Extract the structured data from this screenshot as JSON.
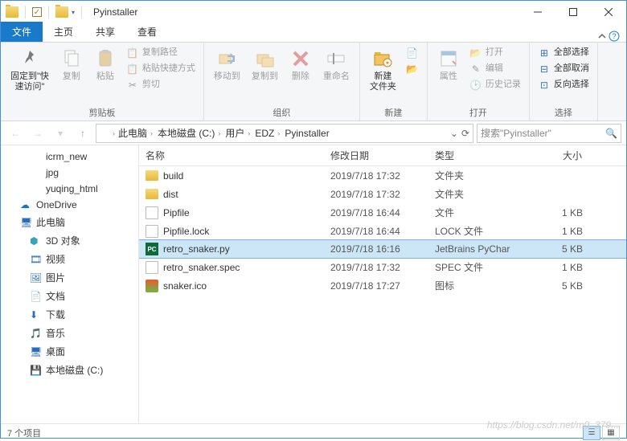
{
  "window": {
    "title": "Pyinstaller"
  },
  "tabs": {
    "file": "文件",
    "home": "主页",
    "share": "共享",
    "view": "查看"
  },
  "ribbon": {
    "pin": "固定到\"快\n速访问\"",
    "copy": "复制",
    "paste": "粘贴",
    "copypath": "复制路径",
    "pasteshortcut": "粘贴快捷方式",
    "cut": "剪切",
    "clipboard": "剪贴板",
    "moveto": "移动到",
    "copyto": "复制到",
    "delete": "删除",
    "rename": "重命名",
    "organize": "组织",
    "newfolder": "新建\n文件夹",
    "new": "新建",
    "properties": "属性",
    "open": "打开",
    "edit": "编辑",
    "history": "历史记录",
    "openg": "打开",
    "selectall": "全部选择",
    "selectnone": "全部取消",
    "invert": "反向选择",
    "select": "选择"
  },
  "breadcrumb": [
    "此电脑",
    "本地磁盘 (C:)",
    "用户",
    "EDZ",
    "Pyinstaller"
  ],
  "search": {
    "placeholder": "搜索\"Pyinstaller\""
  },
  "sidebar": {
    "items": [
      {
        "label": "icrm_new",
        "type": "folder",
        "lvl": 1
      },
      {
        "label": "jpg",
        "type": "folder",
        "lvl": 1
      },
      {
        "label": "yuqing_html",
        "type": "folder",
        "lvl": 1
      },
      {
        "label": "OneDrive",
        "type": "onedrive",
        "lvl": 0
      },
      {
        "label": "此电脑",
        "type": "pc",
        "lvl": 0
      },
      {
        "label": "3D 对象",
        "type": "3d",
        "lvl": 1
      },
      {
        "label": "视频",
        "type": "video",
        "lvl": 1
      },
      {
        "label": "图片",
        "type": "pic",
        "lvl": 1
      },
      {
        "label": "文档",
        "type": "doc",
        "lvl": 1
      },
      {
        "label": "下载",
        "type": "dl",
        "lvl": 1
      },
      {
        "label": "音乐",
        "type": "music",
        "lvl": 1
      },
      {
        "label": "桌面",
        "type": "desktop",
        "lvl": 1
      },
      {
        "label": "本地磁盘 (C:)",
        "type": "drive",
        "lvl": 1
      }
    ]
  },
  "columns": {
    "name": "名称",
    "date": "修改日期",
    "type": "类型",
    "size": "大小"
  },
  "files": [
    {
      "name": "build",
      "date": "2019/7/18 17:32",
      "type": "文件夹",
      "size": "",
      "icon": "folder"
    },
    {
      "name": "dist",
      "date": "2019/7/18 17:32",
      "type": "文件夹",
      "size": "",
      "icon": "folder"
    },
    {
      "name": "Pipfile",
      "date": "2019/7/18 16:44",
      "type": "文件",
      "size": "1 KB",
      "icon": "file"
    },
    {
      "name": "Pipfile.lock",
      "date": "2019/7/18 16:44",
      "type": "LOCK 文件",
      "size": "1 KB",
      "icon": "file"
    },
    {
      "name": "retro_snaker.py",
      "date": "2019/7/18 16:16",
      "type": "JetBrains PyChar",
      "size": "5 KB",
      "icon": "py",
      "selected": true
    },
    {
      "name": "retro_snaker.spec",
      "date": "2019/7/18 17:32",
      "type": "SPEC 文件",
      "size": "1 KB",
      "icon": "file"
    },
    {
      "name": "snaker.ico",
      "date": "2019/7/18 17:27",
      "type": "图标",
      "size": "5 KB",
      "icon": "ico"
    }
  ],
  "status": {
    "count": "7 个项目"
  },
  "watermark": "https://blog.csdn.net/m0_379..."
}
